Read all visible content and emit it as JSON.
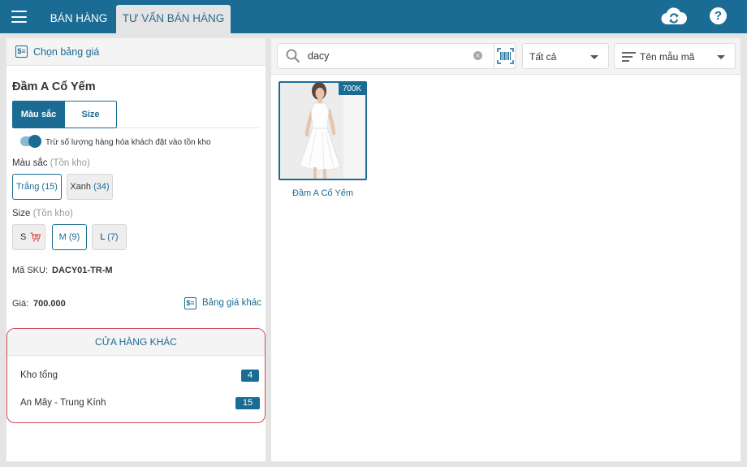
{
  "topbar": {
    "tabs": [
      {
        "label": "BÁN HÀNG"
      },
      {
        "label": "TƯ VẤN BÁN HÀNG"
      }
    ],
    "help_label": "?"
  },
  "left": {
    "choose_price_label": "Chọn bảng giá",
    "price_icon": "$≡",
    "product_title": "Đầm A Cổ Yếm",
    "segments": [
      "Màu sắc",
      "Size"
    ],
    "toggle_label": "Trừ số lượng hàng hóa khách đặt vào tồn kho",
    "toggle_on": true,
    "color_label": "Màu sắc",
    "stock_hint": "(Tồn kho)",
    "colors": [
      {
        "name": "Trắng",
        "count": "(15)"
      },
      {
        "name": "Xanh",
        "count": "(34)"
      }
    ],
    "size_label": "Size",
    "sizes": [
      {
        "name": "S",
        "count": ""
      },
      {
        "name": "M",
        "count": "(9)"
      },
      {
        "name": "L",
        "count": "(7)"
      }
    ],
    "sku_label": "Mã SKU:",
    "sku_value": "DACY01-TR-M",
    "price_label": "Giá:",
    "price_value": "700.000",
    "other_price_label": "Bảng giá khác",
    "stores": {
      "title": "CỬA HÀNG KHÁC",
      "rows": [
        {
          "name": "Kho tổng",
          "qty": "4"
        },
        {
          "name": "An Mây - Trung Kính",
          "qty": "15"
        }
      ]
    }
  },
  "right": {
    "search": {
      "value": "dacy",
      "clear": "×"
    },
    "filter_label": "Tất cả",
    "sort_label": "Tên mẫu mã",
    "products": [
      {
        "name": "Đầm A Cổ Yếm",
        "price_badge": "700K"
      }
    ]
  },
  "colors": {
    "primary": "#1b6c94",
    "highlight_border": "#d44a5a"
  }
}
